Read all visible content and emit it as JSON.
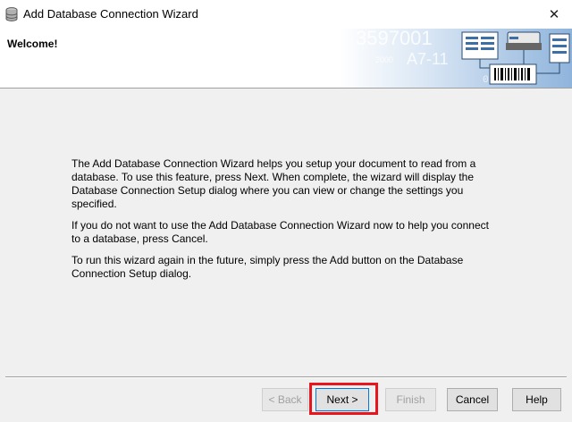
{
  "window": {
    "title": "Add Database Connection Wizard",
    "icon": "database-icon",
    "close_glyph": "✕"
  },
  "header": {
    "title": "Welcome!",
    "graphic": {
      "big_number": "3597001",
      "code": "A7-11",
      "small_text": "2000",
      "binary": "0110"
    }
  },
  "content": {
    "paragraphs": [
      "The Add Database Connection Wizard helps you setup your document to read from a database. To use this feature, press Next.  When complete, the wizard will display the Database Connection Setup dialog where you can view or change the settings you specified.",
      "If you do not want to use the Add Database Connection Wizard now to help you connect to a database, press Cancel.",
      "To run this wizard again in the future, simply press the Add button on the Database Connection Setup dialog."
    ]
  },
  "buttons": {
    "back": "< Back",
    "next": "Next >",
    "finish": "Finish",
    "cancel": "Cancel",
    "help": "Help"
  },
  "colors": {
    "highlight": "#e8141e",
    "default_button_border": "#0078d7",
    "graphic_blue": "#6f9fd0"
  }
}
